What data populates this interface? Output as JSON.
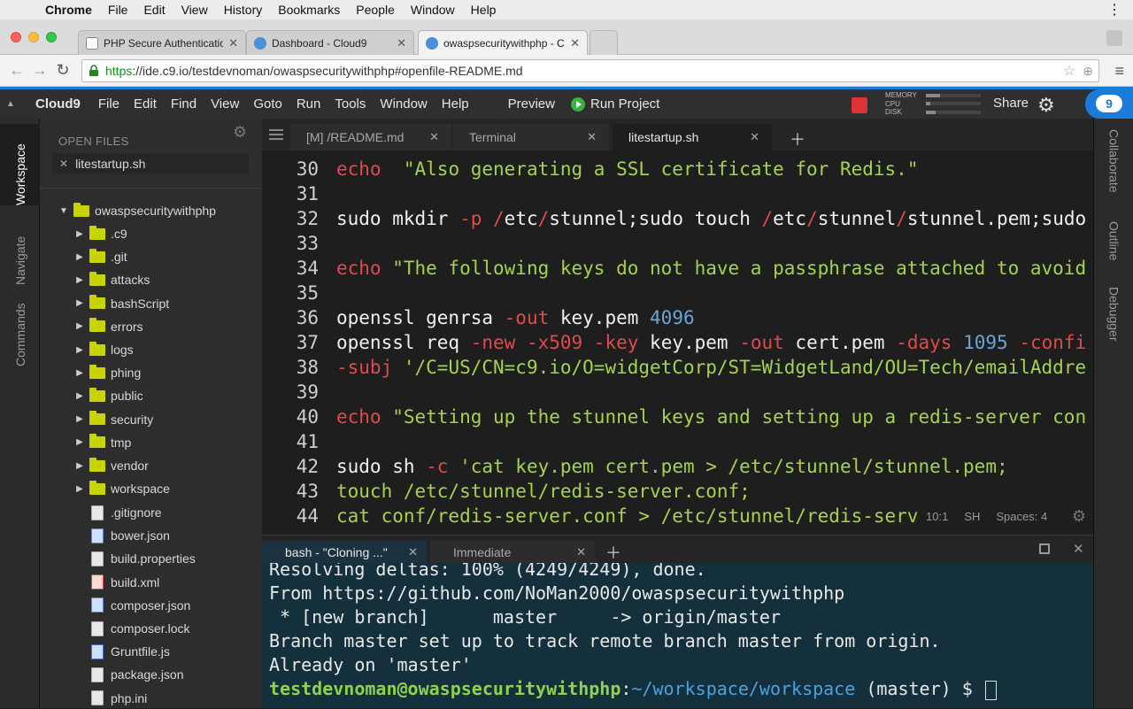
{
  "menubar": {
    "apple": "",
    "app": "Chrome",
    "items": [
      "File",
      "Edit",
      "View",
      "History",
      "Bookmarks",
      "People",
      "Window",
      "Help"
    ],
    "more": "⋮"
  },
  "tabs": [
    {
      "title": "PHP Secure Authentication",
      "icon": "document-icon"
    },
    {
      "title": "Dashboard - Cloud9",
      "icon": "cloud9-icon"
    },
    {
      "title": "owaspsecuritywithphp - Cl",
      "icon": "cloud9-icon"
    }
  ],
  "address": {
    "scheme": "https",
    "rest": "://ide.c9.io/testdevnoman/owaspsecuritywithphp#openfile-README.md"
  },
  "c9": {
    "brand": "Cloud9",
    "menu": [
      "File",
      "Edit",
      "Find",
      "View",
      "Goto",
      "Run",
      "Tools",
      "Window",
      "Help"
    ],
    "preview": "Preview",
    "run": "Run Project",
    "share": "Share",
    "meters": {
      "memory": {
        "label": "MEMORY",
        "level": 0.25
      },
      "cpu": {
        "label": "CPU",
        "level": 0.08
      },
      "disk": {
        "label": "DISK",
        "level": 0.18
      }
    },
    "logo": "9"
  },
  "leftPanel": [
    "Workspace",
    "Navigate",
    "Commands"
  ],
  "rightPanel": [
    "Collaborate",
    "Outline",
    "Debugger"
  ],
  "tree": {
    "header": "OPEN FILES",
    "open": "litestartup.sh",
    "root": "owaspsecuritywithphp",
    "folders": [
      ".c9",
      ".git",
      "attacks",
      "bashScript",
      "errors",
      "logs",
      "phing",
      "public",
      "security",
      "tmp",
      "vendor",
      "workspace"
    ],
    "files": [
      {
        "name": ".gitignore",
        "type": "plain"
      },
      {
        "name": "bower.json",
        "type": "json"
      },
      {
        "name": "build.properties",
        "type": "plain"
      },
      {
        "name": "build.xml",
        "type": "xml"
      },
      {
        "name": "composer.json",
        "type": "json"
      },
      {
        "name": "composer.lock",
        "type": "plain"
      },
      {
        "name": "Gruntfile.js",
        "type": "js"
      },
      {
        "name": "package.json",
        "type": "plain"
      },
      {
        "name": "php.ini",
        "type": "plain"
      }
    ]
  },
  "editorTabs": [
    {
      "label": "[M] /README.md"
    },
    {
      "label": "Terminal"
    },
    {
      "label": "litestartup.sh"
    }
  ],
  "code": [
    {
      "n": "30",
      "tokens": [
        [
          "kw",
          "echo"
        ],
        [
          "",
          "  "
        ],
        [
          "str",
          "\"Also generating a SSL certificate for Redis.\""
        ]
      ]
    },
    {
      "n": "31",
      "tokens": []
    },
    {
      "n": "32",
      "tokens": [
        [
          "",
          "sudo mkdir "
        ],
        [
          "flag",
          "-p"
        ],
        [
          "",
          ""
        ],
        [
          "slash",
          " /"
        ],
        [
          "",
          "etc"
        ],
        [
          "slash",
          "/"
        ],
        [
          "",
          "stunnel;sudo touch "
        ],
        [
          "slash",
          "/"
        ],
        [
          "",
          "etc"
        ],
        [
          "slash",
          "/"
        ],
        [
          "",
          "stunnel"
        ],
        [
          "slash",
          "/"
        ],
        [
          "",
          "stunnel.pem;sudo"
        ]
      ]
    },
    {
      "n": "33",
      "tokens": []
    },
    {
      "n": "34",
      "tokens": [
        [
          "kw",
          "echo"
        ],
        [
          "",
          ""
        ],
        [
          "str",
          " \"The following keys do not have a passphrase attached to avoid"
        ]
      ]
    },
    {
      "n": "35",
      "tokens": []
    },
    {
      "n": "36",
      "tokens": [
        [
          "",
          "openssl genrsa "
        ],
        [
          "flag",
          "-out"
        ],
        [
          "",
          " key.pem "
        ],
        [
          "num",
          "4096"
        ]
      ]
    },
    {
      "n": "37",
      "tokens": [
        [
          "",
          "openssl req "
        ],
        [
          "flag",
          "-new"
        ],
        [
          "",
          " "
        ],
        [
          "flag",
          "-x509"
        ],
        [
          "",
          " "
        ],
        [
          "flag",
          "-key"
        ],
        [
          "",
          " key.pem "
        ],
        [
          "flag",
          "-out"
        ],
        [
          "",
          " cert.pem "
        ],
        [
          "flag",
          "-days"
        ],
        [
          "",
          " "
        ],
        [
          "num",
          "1095"
        ],
        [
          "",
          " "
        ],
        [
          "flag",
          "-confi"
        ]
      ]
    },
    {
      "n": "38",
      "tokens": [
        [
          "flag",
          "-subj"
        ],
        [
          "",
          " "
        ],
        [
          "str",
          "'/C=US/CN=c9.io/O=widgetCorp/ST=WidgetLand/OU=Tech/emailAddre"
        ]
      ]
    },
    {
      "n": "39",
      "tokens": []
    },
    {
      "n": "40",
      "tokens": [
        [
          "kw",
          "echo"
        ],
        [
          "",
          ""
        ],
        [
          "str",
          " \"Setting up the stunnel keys and setting up a redis-server con"
        ]
      ]
    },
    {
      "n": "41",
      "tokens": []
    },
    {
      "n": "42",
      "tokens": [
        [
          "",
          "sudo sh "
        ],
        [
          "flag",
          "-c"
        ],
        [
          "",
          ""
        ],
        [
          "str",
          " 'cat key.pem cert.pem > /etc/stunnel/stunnel.pem;"
        ]
      ]
    },
    {
      "n": "43",
      "tokens": [
        [
          "str",
          "touch /etc/stunnel/redis-server.conf;"
        ]
      ]
    },
    {
      "n": "44",
      "tokens": [
        [
          "str",
          "cat conf/redis-server.conf > /etc/stunnel/redis-serv"
        ]
      ]
    }
  ],
  "status": {
    "pos": "10:1",
    "mode": "SH",
    "spaces": "Spaces: 4"
  },
  "consoleTabs": [
    {
      "label": "bash - \"Cloning ...\""
    },
    {
      "label": "Immediate"
    }
  ],
  "terminal": {
    "lines": [
      "Resolving deltas: 100% (4249/4249), done.",
      "From https://github.com/NoMan2000/owaspsecuritywithphp",
      " * [new branch]      master     -> origin/master",
      "Branch master set up to track remote branch master from origin.",
      "Already on 'master'"
    ],
    "prompt": {
      "user": "testdevnoman@owaspsecuritywithphp",
      "sep": ":",
      "path": "~/workspace/workspace",
      "branch": " (master) $ "
    }
  }
}
